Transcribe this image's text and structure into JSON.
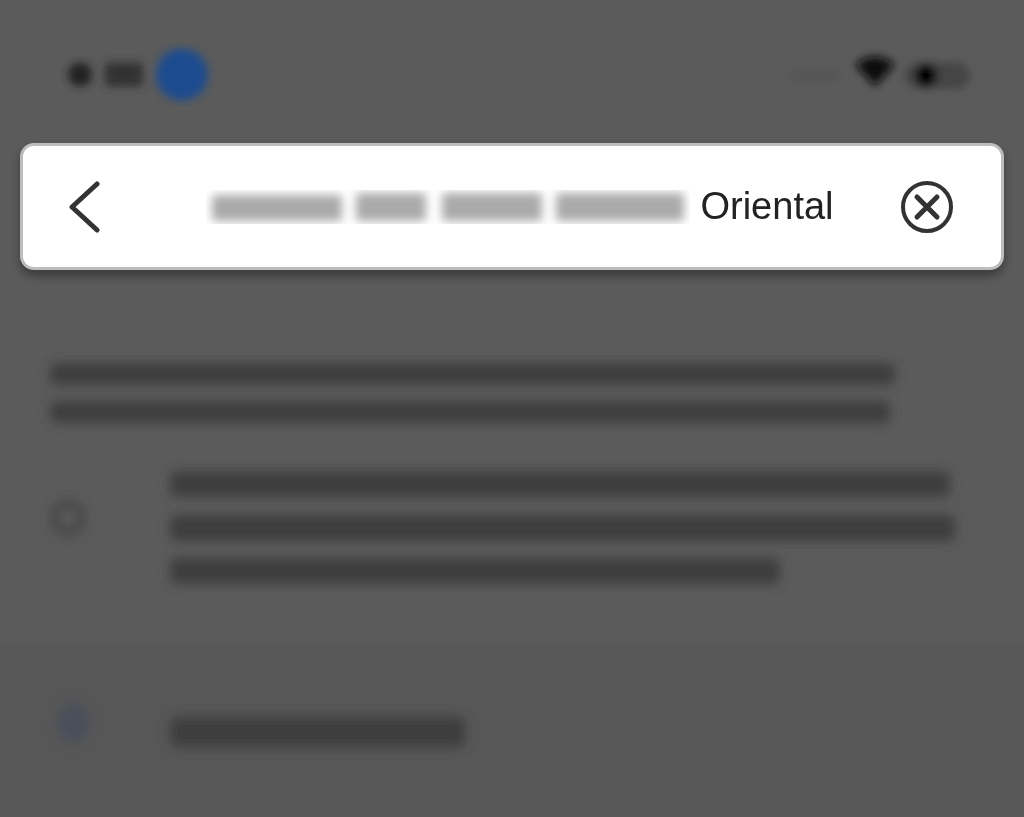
{
  "search": {
    "value": "Oriental"
  }
}
